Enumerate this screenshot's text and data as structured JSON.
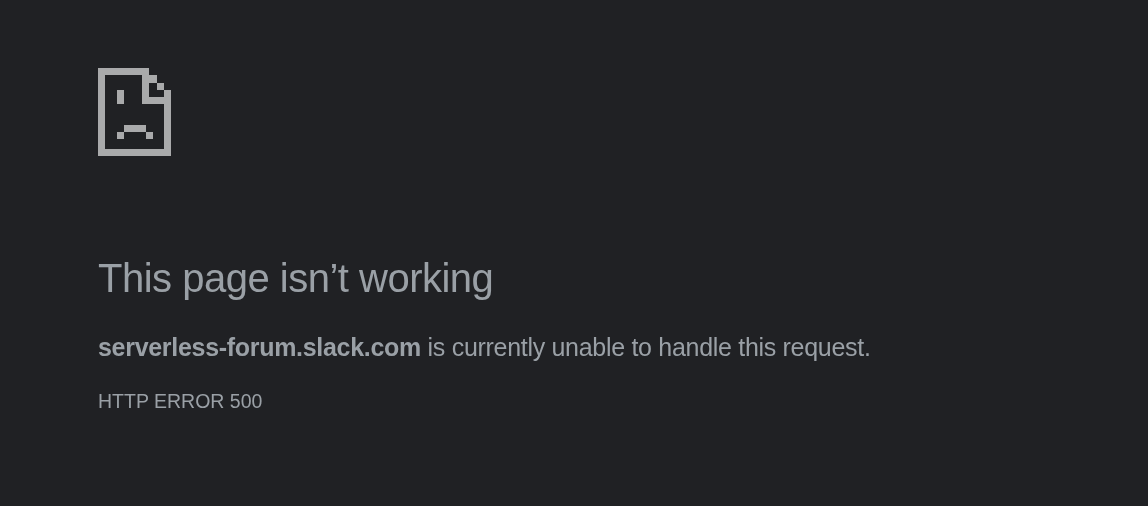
{
  "heading": "This page isn’t working",
  "message": "**serverless-forum.slack.com** is currently unable to handle this request.",
  "error_code": "HTTP ERROR 500"
}
